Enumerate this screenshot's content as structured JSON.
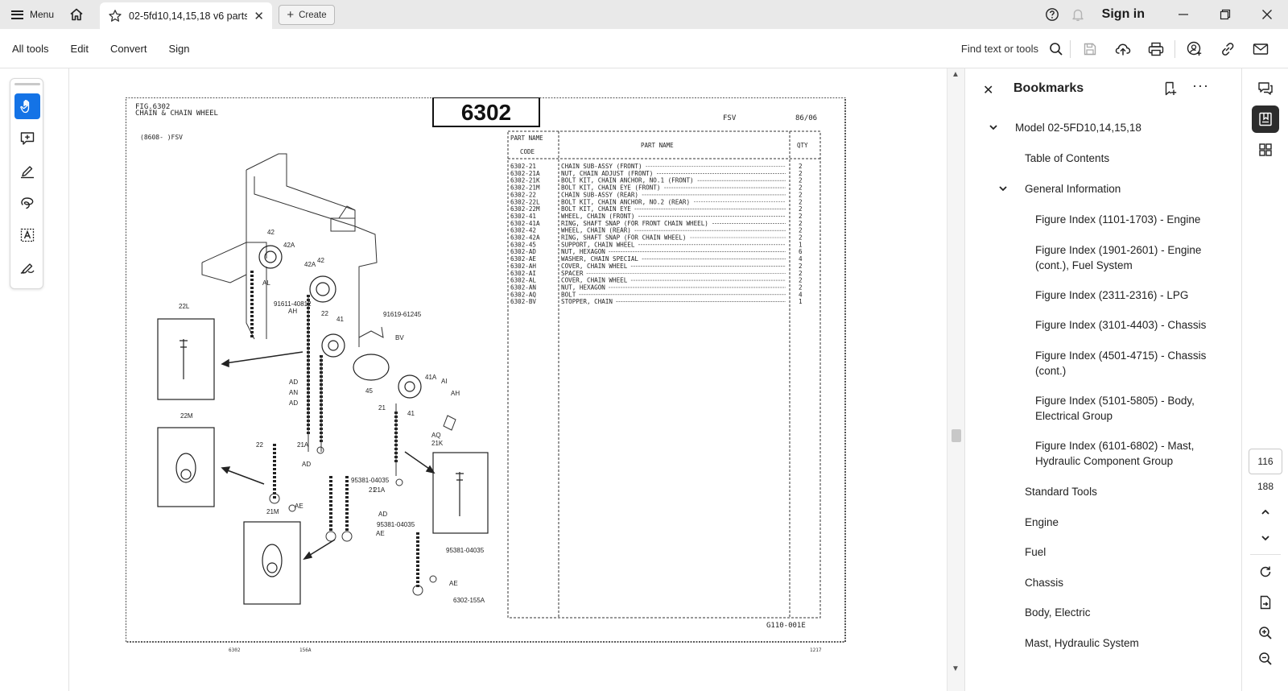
{
  "titlebar": {
    "menu_label": "Menu",
    "tab_title": "02-5fd10,14,15,18 v6 parts...",
    "tab_close": "✕",
    "create_label": "Create",
    "sign_in": "Sign in"
  },
  "toolbar": {
    "menus": [
      "All tools",
      "Edit",
      "Convert",
      "Sign"
    ],
    "find_text": "Find text or tools"
  },
  "document": {
    "fig_number": "6302",
    "fig_title_line1": "FIG.6302",
    "fig_title_line2": "CHAIN & CHAIN WHEEL",
    "model_range": "(8608-    )FSV",
    "fsv": "FSV",
    "date": "86/06",
    "table_headers": {
      "part_code_line1": "PART NAME",
      "part_code_line2": "CODE",
      "part_name": "PART  NAME",
      "qty": "QTY"
    },
    "parts": [
      {
        "code": "6302-21",
        "name": "CHAIN SUB-ASSY (FRONT)",
        "qty": "2"
      },
      {
        "code": "6302-21A",
        "name": "NUT, CHAIN ADJUST (FRONT)",
        "qty": "2"
      },
      {
        "code": "6302-21K",
        "name": "BOLT KIT, CHAIN ANCHOR, NO.1 (FRONT)",
        "qty": "2"
      },
      {
        "code": "6302-21M",
        "name": "BOLT KIT, CHAIN EYE (FRONT)",
        "qty": "2"
      },
      {
        "code": "6302-22",
        "name": "CHAIN SUB-ASSY (REAR)",
        "qty": "2"
      },
      {
        "code": "6302-22L",
        "name": "BOLT KIT, CHAIN ANCHOR, NO.2 (REAR)",
        "qty": "2"
      },
      {
        "code": "6302-22M",
        "name": "BOLT KIT, CHAIN EYE",
        "qty": "2"
      },
      {
        "code": "6302-41",
        "name": "WHEEL, CHAIN (FRONT)",
        "qty": "2"
      },
      {
        "code": "6302-41A",
        "name": "RING, SHAFT SNAP (FOR FRONT CHAIN WHEEL)",
        "qty": "2"
      },
      {
        "code": "6302-42",
        "name": "WHEEL, CHAIN (REAR)",
        "qty": "2"
      },
      {
        "code": "6302-42A",
        "name": "RING, SHAFT SNAP (FOR CHAIN WHEEL)",
        "qty": "2"
      },
      {
        "code": "6302-45",
        "name": "SUPPORT, CHAIN WHEEL",
        "qty": "1"
      },
      {
        "code": "6302-AD",
        "name": "NUT, HEXAGON",
        "qty": "6"
      },
      {
        "code": "6302-AE",
        "name": "WASHER, CHAIN SPECIAL",
        "qty": "4"
      },
      {
        "code": "6302-AH",
        "name": "COVER, CHAIN WHEEL",
        "qty": "2"
      },
      {
        "code": "6302-AI",
        "name": "SPACER",
        "qty": "2"
      },
      {
        "code": "6302-AL",
        "name": "COVER, CHAIN WHEEL",
        "qty": "2"
      },
      {
        "code": "6302-AN",
        "name": "NUT, HEXAGON",
        "qty": "2"
      },
      {
        "code": "6302-AQ",
        "name": "BOLT",
        "qty": "4"
      },
      {
        "code": "6302-BV",
        "name": "STOPPER, CHAIN",
        "qty": "1"
      }
    ],
    "callouts": [
      "42",
      "42A",
      "42A",
      "42",
      "AL",
      "91611-40812",
      "AH",
      "22",
      "91619-61245",
      "41",
      "BV",
      "22L",
      "AD",
      "AN",
      "AD",
      "45",
      "41A",
      "AI",
      "AH",
      "21",
      "41",
      "AQ",
      "21K",
      "22M",
      "22",
      "21A",
      "AD",
      "95381-04035",
      "21",
      "21A",
      "AD",
      "95381-04035",
      "AE",
      "AE",
      "21M",
      "95381-04035",
      "AE",
      "6302-155A"
    ],
    "footer_code": "G110-001E",
    "page_foot_left": "6302",
    "page_foot_mid": "156A",
    "page_foot_right": "1217"
  },
  "bookmarks": {
    "title": "Bookmarks",
    "items": [
      {
        "label": "Model 02-5FD10,14,15,18",
        "level": 0,
        "expanded": true
      },
      {
        "label": "Table of Contents",
        "level": 1
      },
      {
        "label": "General Information",
        "level": 1,
        "expanded": true
      },
      {
        "label": "Figure Index (1101-1703) - Engine",
        "level": 2
      },
      {
        "label": "Figure Index (1901-2601) - Engine (cont.), Fuel System",
        "level": 2
      },
      {
        "label": "Figure Index (2311-2316) - LPG",
        "level": 2
      },
      {
        "label": "Figure Index (3101-4403) - Chassis",
        "level": 2
      },
      {
        "label": "Figure Index (4501-4715) - Chassis (cont.)",
        "level": 2
      },
      {
        "label": "Figure Index (5101-5805) - Body, Electrical Group",
        "level": 2
      },
      {
        "label": "Figure Index (6101-6802) - Mast, Hydraulic Component Group",
        "level": 2
      },
      {
        "label": "Standard Tools",
        "level": 1
      },
      {
        "label": "Engine",
        "level": 1
      },
      {
        "label": "Fuel",
        "level": 1
      },
      {
        "label": "Chassis",
        "level": 1
      },
      {
        "label": "Body, Electric",
        "level": 1
      },
      {
        "label": "Mast, Hydraulic System",
        "level": 1
      }
    ]
  },
  "navigation": {
    "current_page": "116",
    "total_pages": "188"
  },
  "colors": {
    "accent": "#1473e6",
    "titlebar_bg": "#e9e9e9",
    "active_rail": "#2c2c2c"
  }
}
